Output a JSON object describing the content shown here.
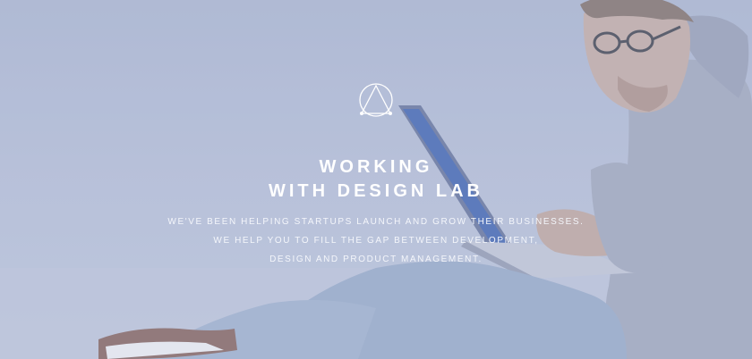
{
  "hero": {
    "title_line1": "WORKING",
    "title_line2": "WITH DESIGN LAB",
    "desc_line1": "WE'VE BEEN HELPING STARTUPS LAUNCH AND GROW THEIR BUSINESSES.",
    "desc_line2": "WE HELP YOU TO FILL THE GAP BETWEEN DEVELOPMENT,",
    "desc_line3": "DESIGN AND PRODUCT MANAGEMENT."
  },
  "icons": {
    "logo": "triangle-in-circle-logo-icon"
  },
  "colors": {
    "background": "#b7c0d8",
    "text": "#ffffff",
    "hoodie": "#a9b0c4",
    "laptop_screen": "#4e6fb8"
  }
}
